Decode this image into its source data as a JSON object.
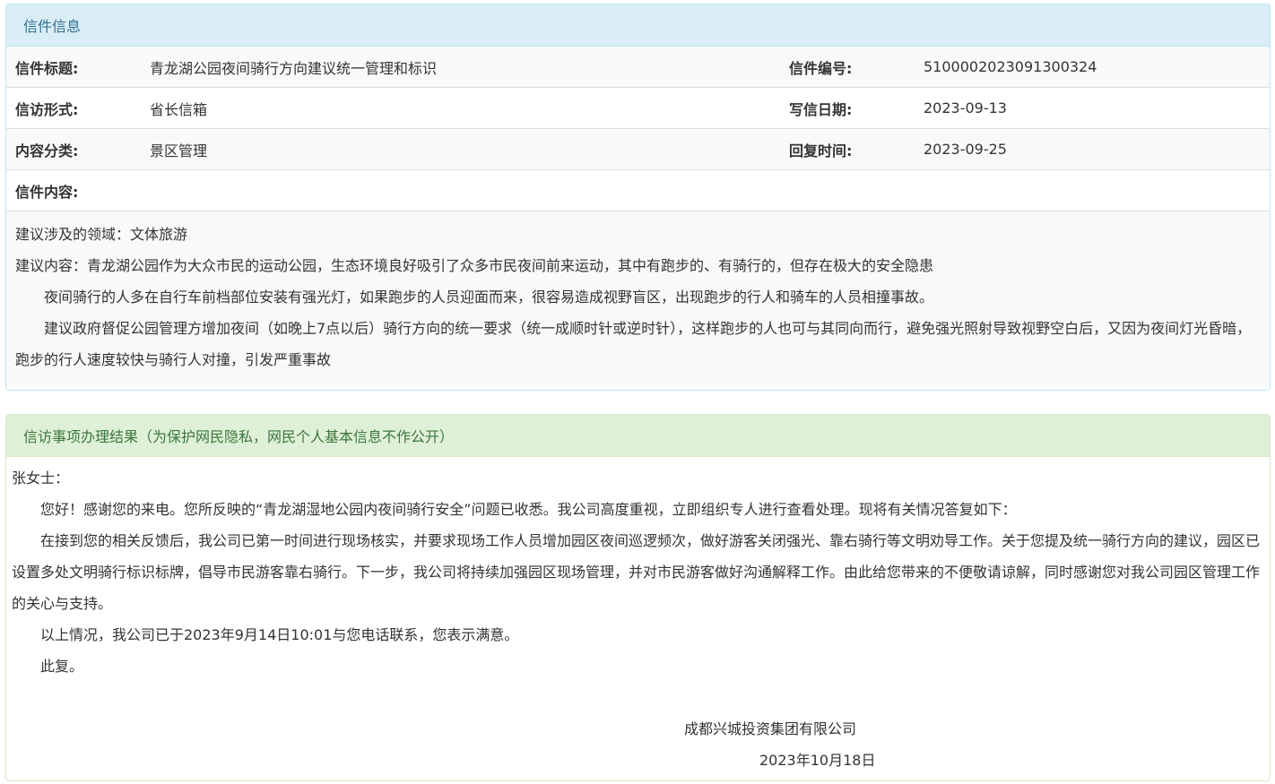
{
  "letter_panel": {
    "heading": "信件信息",
    "rows": [
      {
        "label1": "信件标题:",
        "value1": "青龙湖公园夜间骑行方向建议统一管理和标识",
        "label2": "信件编号:",
        "value2": "5100002023091300324"
      },
      {
        "label1": "信访形式:",
        "value1": "省长信箱",
        "label2": "写信日期:",
        "value2": "2023-09-13"
      },
      {
        "label1": "内容分类:",
        "value1": "景区管理",
        "label2": "回复时间:",
        "value2": "2023-09-25"
      }
    ],
    "content_label": "信件内容:",
    "content": [
      "建议涉及的领域：文体旅游",
      "建议内容：青龙湖公园作为大众市民的运动公园，生态环境良好吸引了众多市民夜间前来运动，其中有跑步的、有骑行的，但存在极大的安全隐患",
      "夜间骑行的人多在自行车前档部位安装有强光灯，如果跑步的人员迎面而来，很容易造成视野盲区，出现跑步的行人和骑车的人员相撞事故。",
      "建议政府督促公园管理方增加夜间（如晚上7点以后）骑行方向的统一要求（统一成顺时针或逆时针），这样跑步的人也可与其同向而行，避免强光照射导致视野空白后，又因为夜间灯光昏暗，跑步的行人速度较快与骑行人对撞，引发严重事故"
    ]
  },
  "result_panel": {
    "heading": "信访事项办理结果（为保护网民隐私，网民个人基本信息不作公开）",
    "greeting": "张女士：",
    "paragraphs": [
      "您好！感谢您的来电。您所反映的“青龙湖湿地公园内夜间骑行安全”问题已收悉。我公司高度重视，立即组织专人进行查看处理。现将有关情况答复如下：",
      "在接到您的相关反馈后，我公司已第一时间进行现场核实，并要求现场工作人员增加园区夜间巡逻频次，做好游客关闭强光、靠右骑行等文明劝导工作。关于您提及统一骑行方向的建议，园区已设置多处文明骑行标识标牌，倡导市民游客靠右骑行。下一步，我公司将持续加强园区现场管理，并对市民游客做好沟通解释工作。由此给您带来的不便敬请谅解，同时感谢您对我公司园区管理工作的关心与支持。",
      "以上情况，我公司已于2023年9月14日10:01与您电话联系，您表示满意。",
      "此复。"
    ],
    "signature_company": "成都兴城投资集团有限公司",
    "signature_date": "2023年10月18日"
  }
}
